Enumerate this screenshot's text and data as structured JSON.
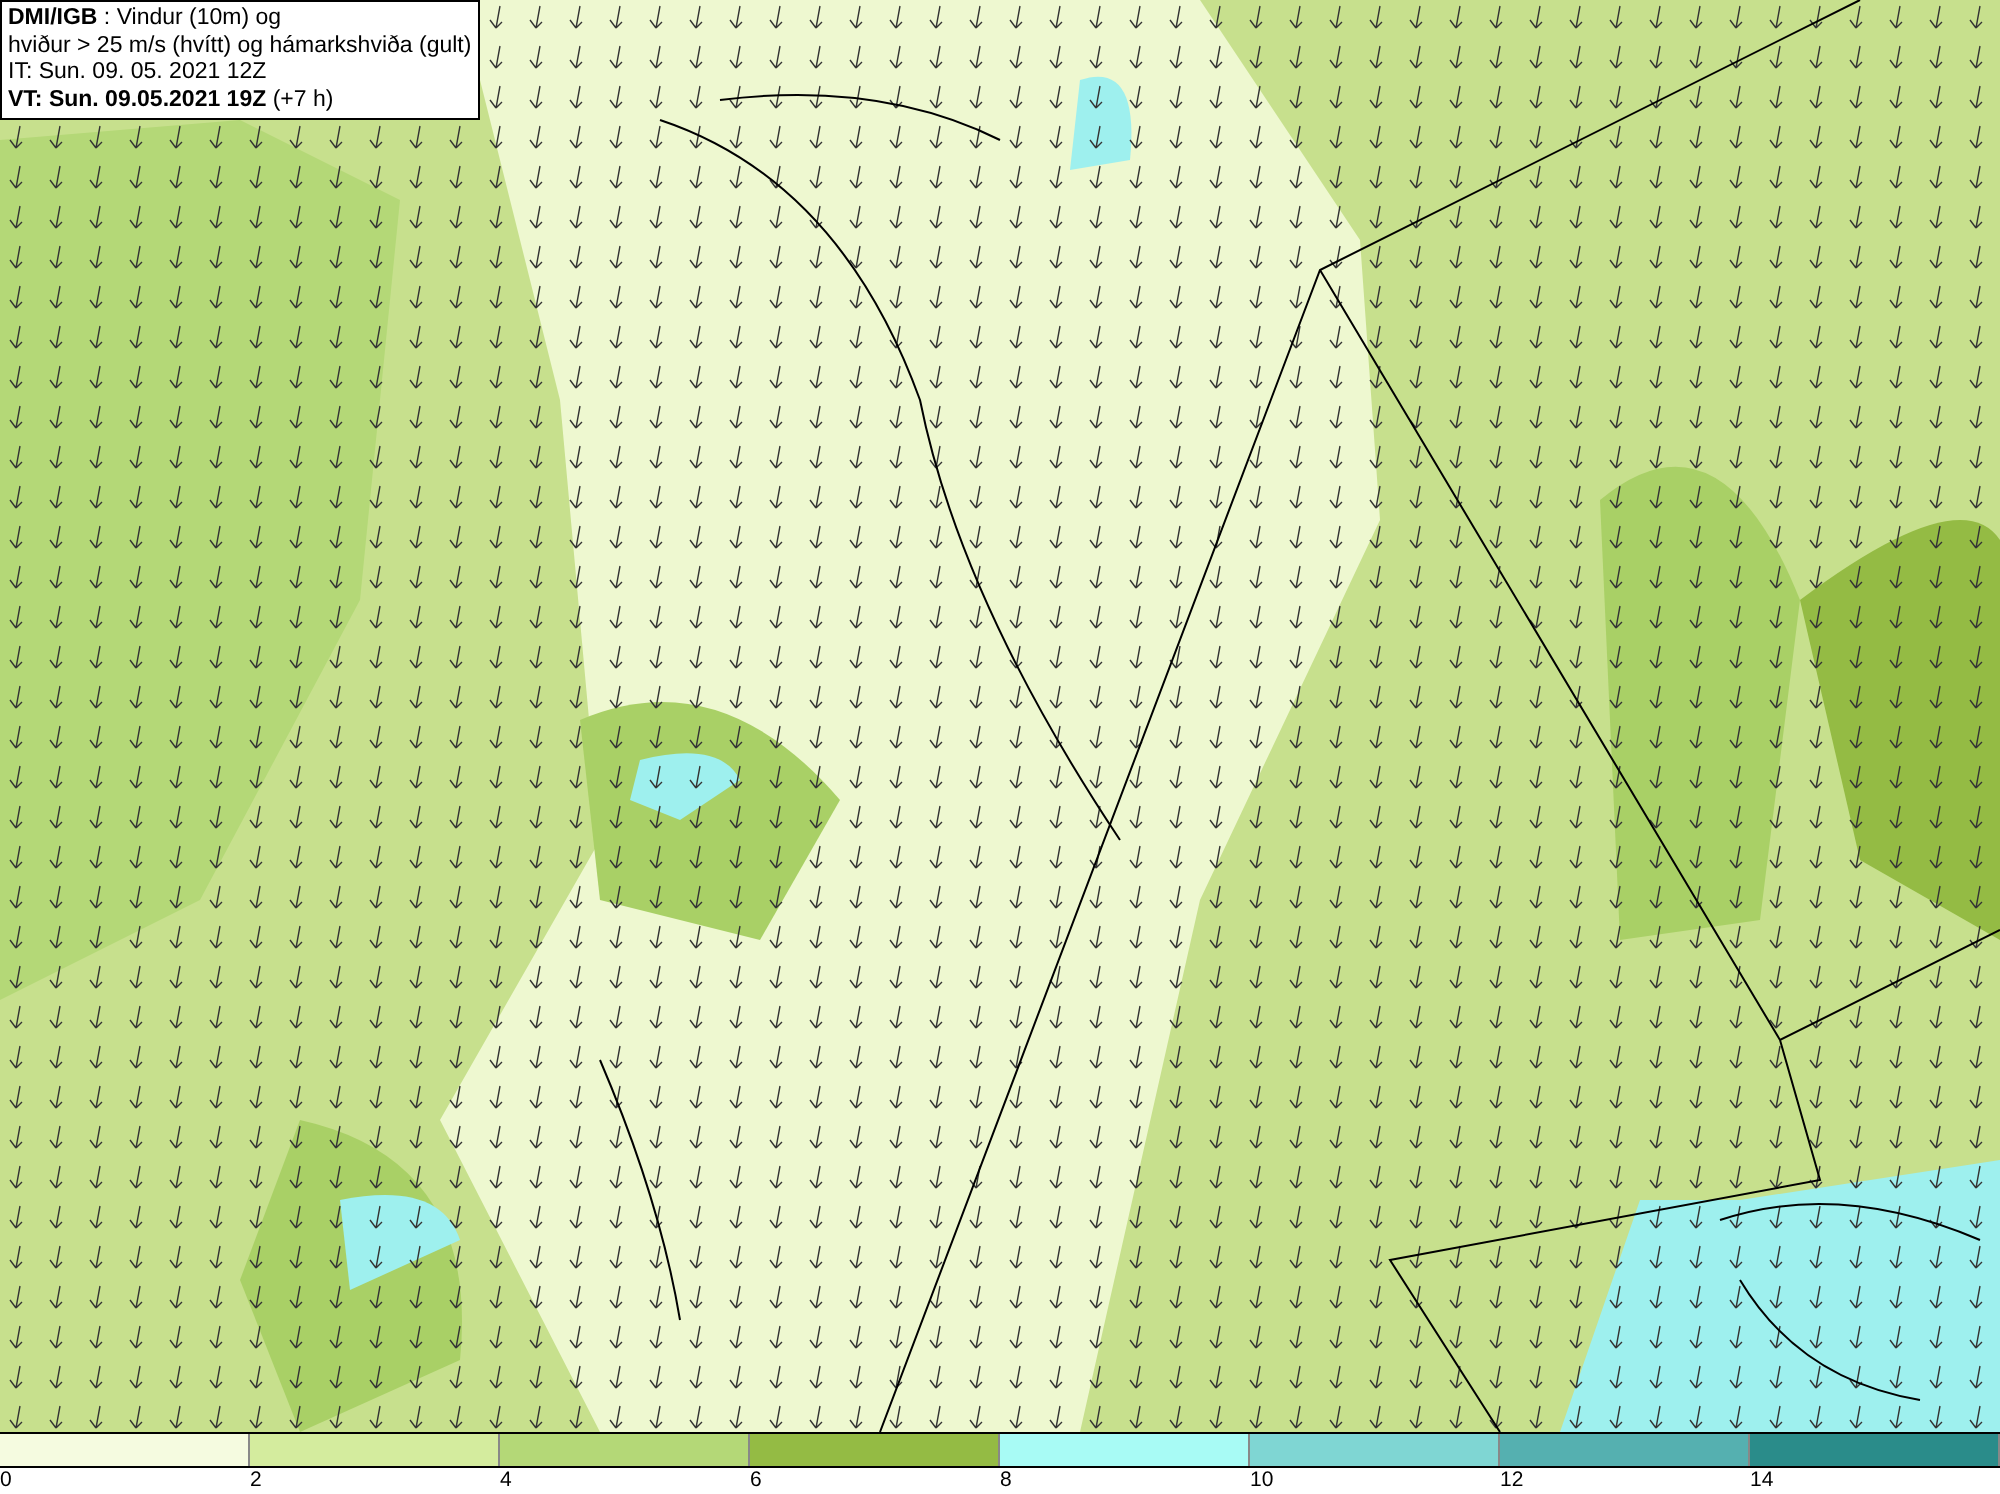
{
  "info_box": {
    "lines": [
      "**DMI/IGB** : Vindur (10m) og",
      "hviður > 25 m/s (hvítt) og hámarkshviða (gult)",
      "IT: Sun. 09. 05. 2021 12Z",
      "**VT: Sun. 09.05.2021 19Z** (+7 h)"
    ]
  },
  "legend": {
    "segments": [
      {
        "color": "#f5fbe0",
        "label": "0"
      },
      {
        "color": "#d4ec9e",
        "label": "2"
      },
      {
        "color": "#b4d877",
        "label": "4"
      },
      {
        "color": "#94bb44",
        "label": "6"
      },
      {
        "color": "#a8fbf5",
        "label": "8"
      },
      {
        "color": "#7fd6d3",
        "label": "10"
      },
      {
        "color": "#55b0b0",
        "label": "12"
      },
      {
        "color": "#2a8c8a",
        "label": "14"
      }
    ]
  }
}
